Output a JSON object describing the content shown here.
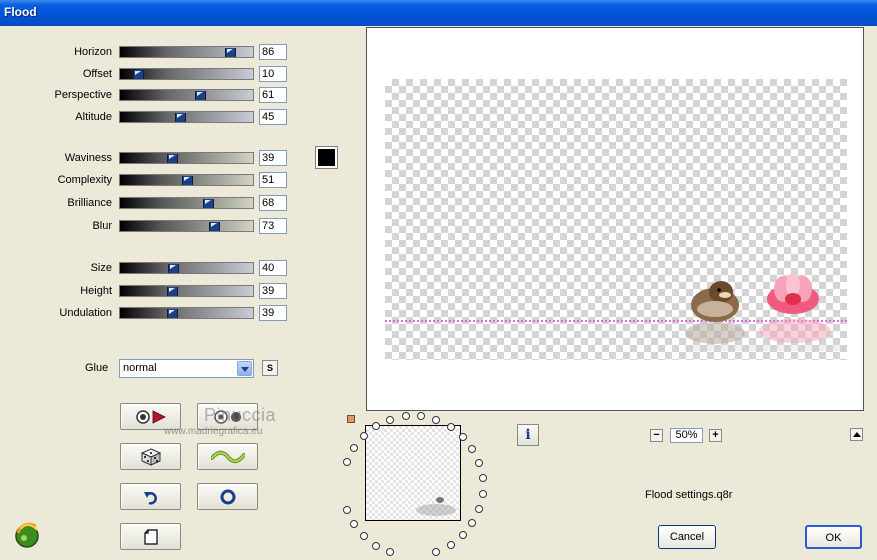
{
  "window": {
    "title": "Flood"
  },
  "sliders_group1": [
    {
      "label": "Horizon",
      "value": "86"
    },
    {
      "label": "Offset",
      "value": "10"
    },
    {
      "label": "Perspective",
      "value": "61"
    },
    {
      "label": "Altitude",
      "value": "45"
    }
  ],
  "sliders_group2": [
    {
      "label": "Waviness",
      "value": "39"
    },
    {
      "label": "Complexity",
      "value": "51"
    },
    {
      "label": "Brilliance",
      "value": "68"
    },
    {
      "label": "Blur",
      "value": "73"
    }
  ],
  "sliders_group3": [
    {
      "label": "Size",
      "value": "40"
    },
    {
      "label": "Height",
      "value": "39"
    },
    {
      "label": "Undulation",
      "value": "39"
    }
  ],
  "flood_color": "#000000",
  "glue": {
    "label": "Glue",
    "selected": "normal"
  },
  "small_button": {
    "label": "S"
  },
  "watermark": {
    "line1": "Pinuccia",
    "line2": "www.madriegrafica.eu"
  },
  "icons": {
    "row1_left": "eye-play-icon",
    "row1_right": "gear-record-icon",
    "row2_left": "dice-icon",
    "row2_right": "wave-icon",
    "row3_left": "undo-icon",
    "row3_right": "circle-icon",
    "row4_left": "page-icon",
    "app": "plugin-logo-icon"
  },
  "preview": {
    "zoom": "50%",
    "zoom_out": "−",
    "zoom_in": "+",
    "info": "i"
  },
  "settings_file": "Flood settings.q8r",
  "buttons": {
    "cancel": "Cancel",
    "ok": "OK"
  }
}
